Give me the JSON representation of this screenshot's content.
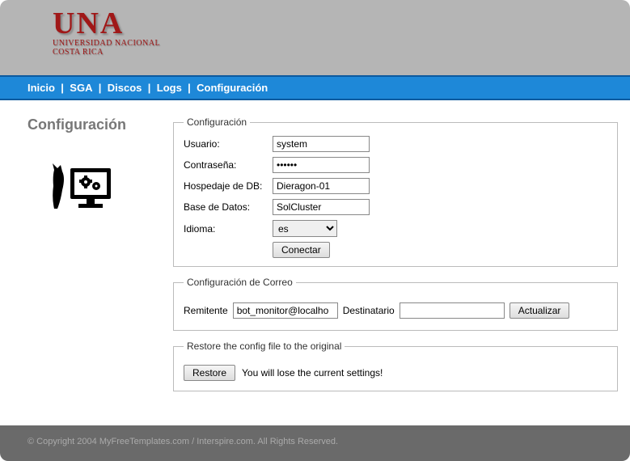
{
  "logo": {
    "main": "UNA",
    "sub1": "UNIVERSIDAD NACIONAL",
    "sub2": "COSTA RICA"
  },
  "nav": {
    "items": [
      "Inicio",
      "SGA",
      "Discos",
      "Logs",
      "Configuración"
    ]
  },
  "sidebar": {
    "title": "Configuración"
  },
  "config": {
    "legend": "Configuración",
    "user_label": "Usuario:",
    "user_value": "system",
    "pass_label": "Contraseña:",
    "pass_value": "••••••",
    "host_label": "Hospedaje de DB:",
    "host_value": "Dieragon-01",
    "db_label": "Base de Datos:",
    "db_value": "SolCluster",
    "lang_label": "Idioma:",
    "lang_value": "es",
    "connect_btn": "Conectar"
  },
  "mail": {
    "legend": "Configuración de Correo",
    "sender_label": "Remitente",
    "sender_value": "bot_monitor@localho",
    "recipient_label": "Destinatario",
    "recipient_value": "",
    "update_btn": "Actualizar"
  },
  "restore": {
    "legend": "Restore the config file to the original",
    "btn": "Restore",
    "warning": "You will lose the current settings!"
  },
  "footer": {
    "text": "© Copyright 2004 MyFreeTemplates.com / Interspire.com. All Rights Reserved."
  }
}
